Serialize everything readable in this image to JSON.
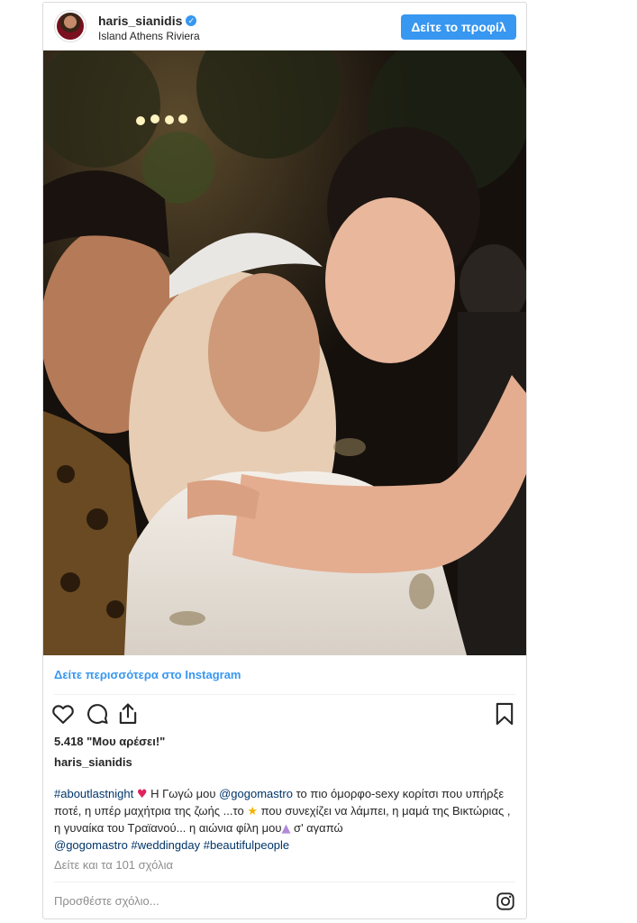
{
  "post": {
    "username": "haris_sianidis",
    "verified": true,
    "location": "Island Athens Riviera",
    "profile_button": "Δείτε το προφίλ",
    "see_more": "Δείτε περισσότερα στο Instagram",
    "likes": "5.418 \"Μου αρέσει!\"",
    "author": "haris_sianidis",
    "caption": {
      "hashtag_main": "#aboutlastnight",
      "text_1": " Η Γωγώ μου ",
      "mention_1": "@gogomastro",
      "text_2": " το πιο όμορφο-sexy κορίτσι που υπήρξε ποτέ, η υπέρ μαχήτρια της ζωής ...το ",
      "text_3": " που συνεχίζει να λάμπει, η μαμά της Βικτώριας , η γυναίκα του Τραϊανού... η αιώνια φίλη μου",
      "text_4": " σ' αγαπώ ",
      "mention_2": "@gogomastro",
      "hashtag_2": "#weddingday",
      "hashtag_3": "#beautifulpeople"
    },
    "comments_link": "Δείτε και τα 101 σχόλια",
    "comment_placeholder": "Προσθέστε σχόλιο...",
    "icons": {
      "like": "heart-outline-icon",
      "comment": "comment-bubble-icon",
      "share": "share-icon",
      "save": "bookmark-icon",
      "instagram": "instagram-logo-icon"
    },
    "colors": {
      "accent": "#3897f0",
      "hashtag": "#003569",
      "muted": "#8e8e8e",
      "border": "#dbdbdb"
    }
  }
}
